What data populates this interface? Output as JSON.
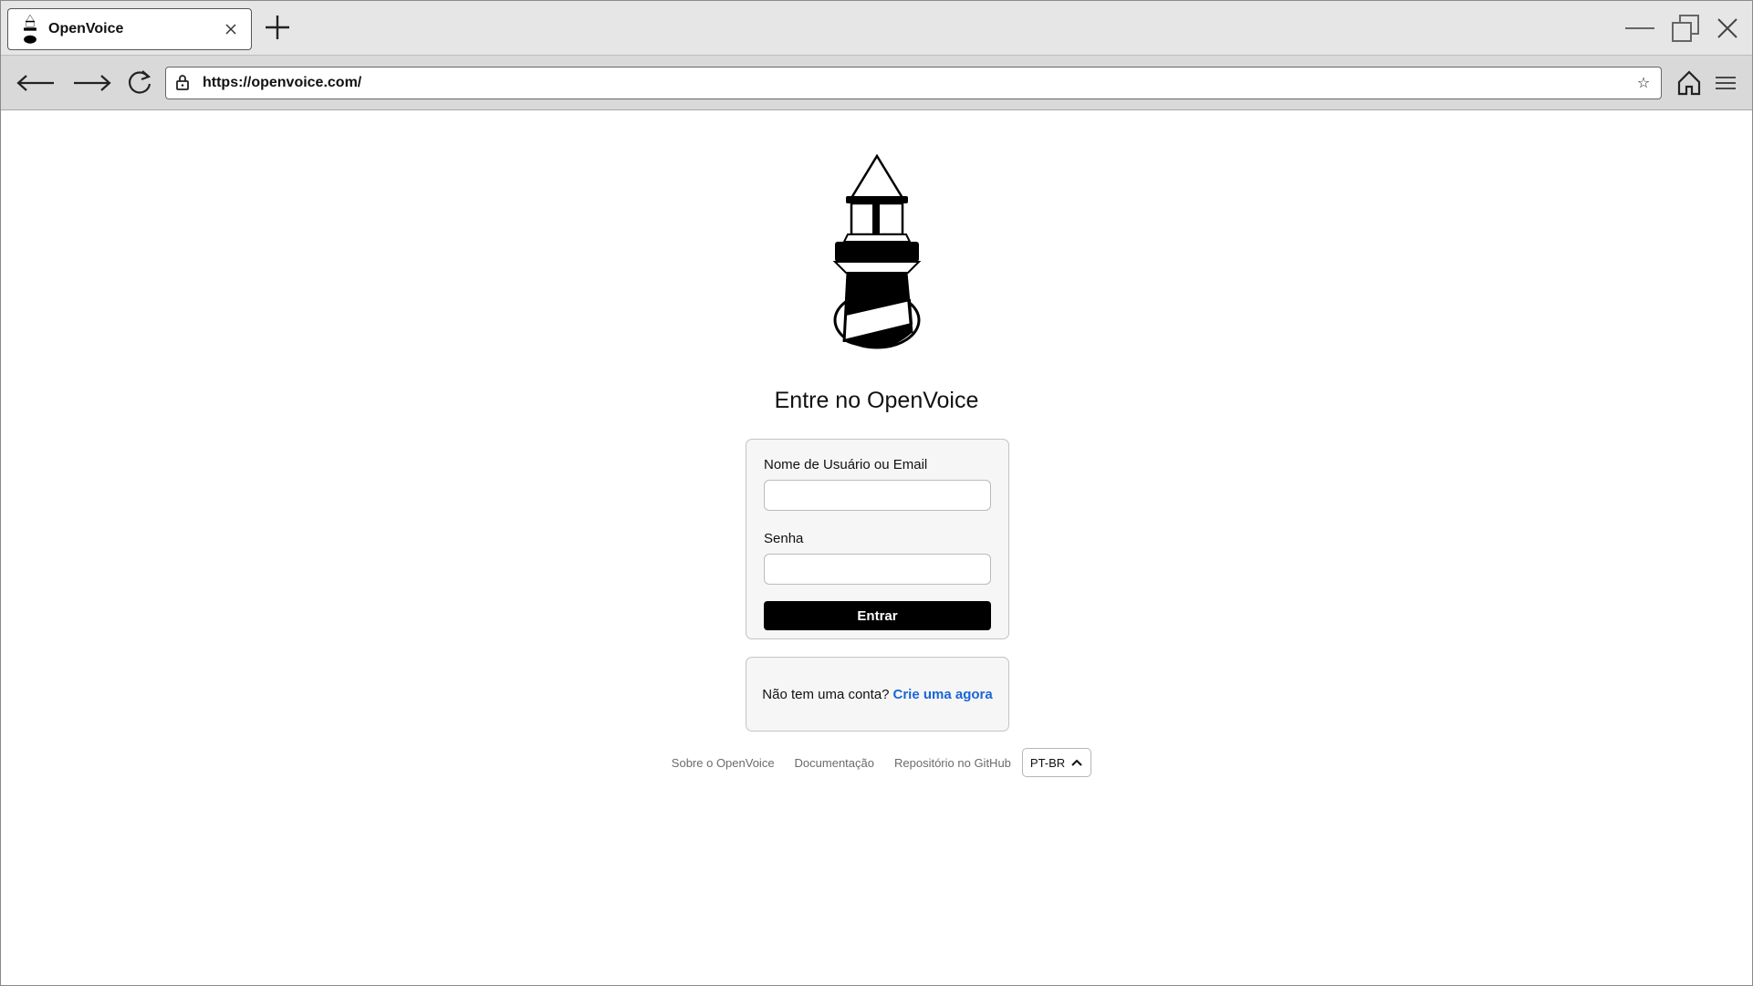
{
  "browser": {
    "tab_title": "OpenVoice",
    "url": "https://openvoice.com/"
  },
  "page": {
    "heading": "Entre no OpenVoice",
    "login_form": {
      "username_label": "Nome de Usuário ou Email",
      "username_value": "",
      "password_label": "Senha",
      "password_value": "",
      "submit_label": "Entrar"
    },
    "signup": {
      "prompt": "Não tem uma conta?",
      "link": "Crie uma agora"
    },
    "footer": {
      "links": [
        "Sobre o OpenVoice",
        "Documentação",
        "Repositório no GitHub"
      ],
      "language": "PT-BR"
    }
  },
  "colors": {
    "accent_link": "#1a66d6",
    "primary_button": "#000000"
  },
  "icons": {
    "favicon": "lighthouse-icon",
    "tab_close": "close-icon",
    "new_tab": "plus-icon",
    "back": "arrow-left-icon",
    "forward": "arrow-right-icon",
    "reload": "reload-icon",
    "lock": "lock-icon",
    "bookmark": "star-icon",
    "home": "home-icon",
    "menu": "hamburger-menu-icon",
    "language_toggle": "chevron-up-icon"
  }
}
